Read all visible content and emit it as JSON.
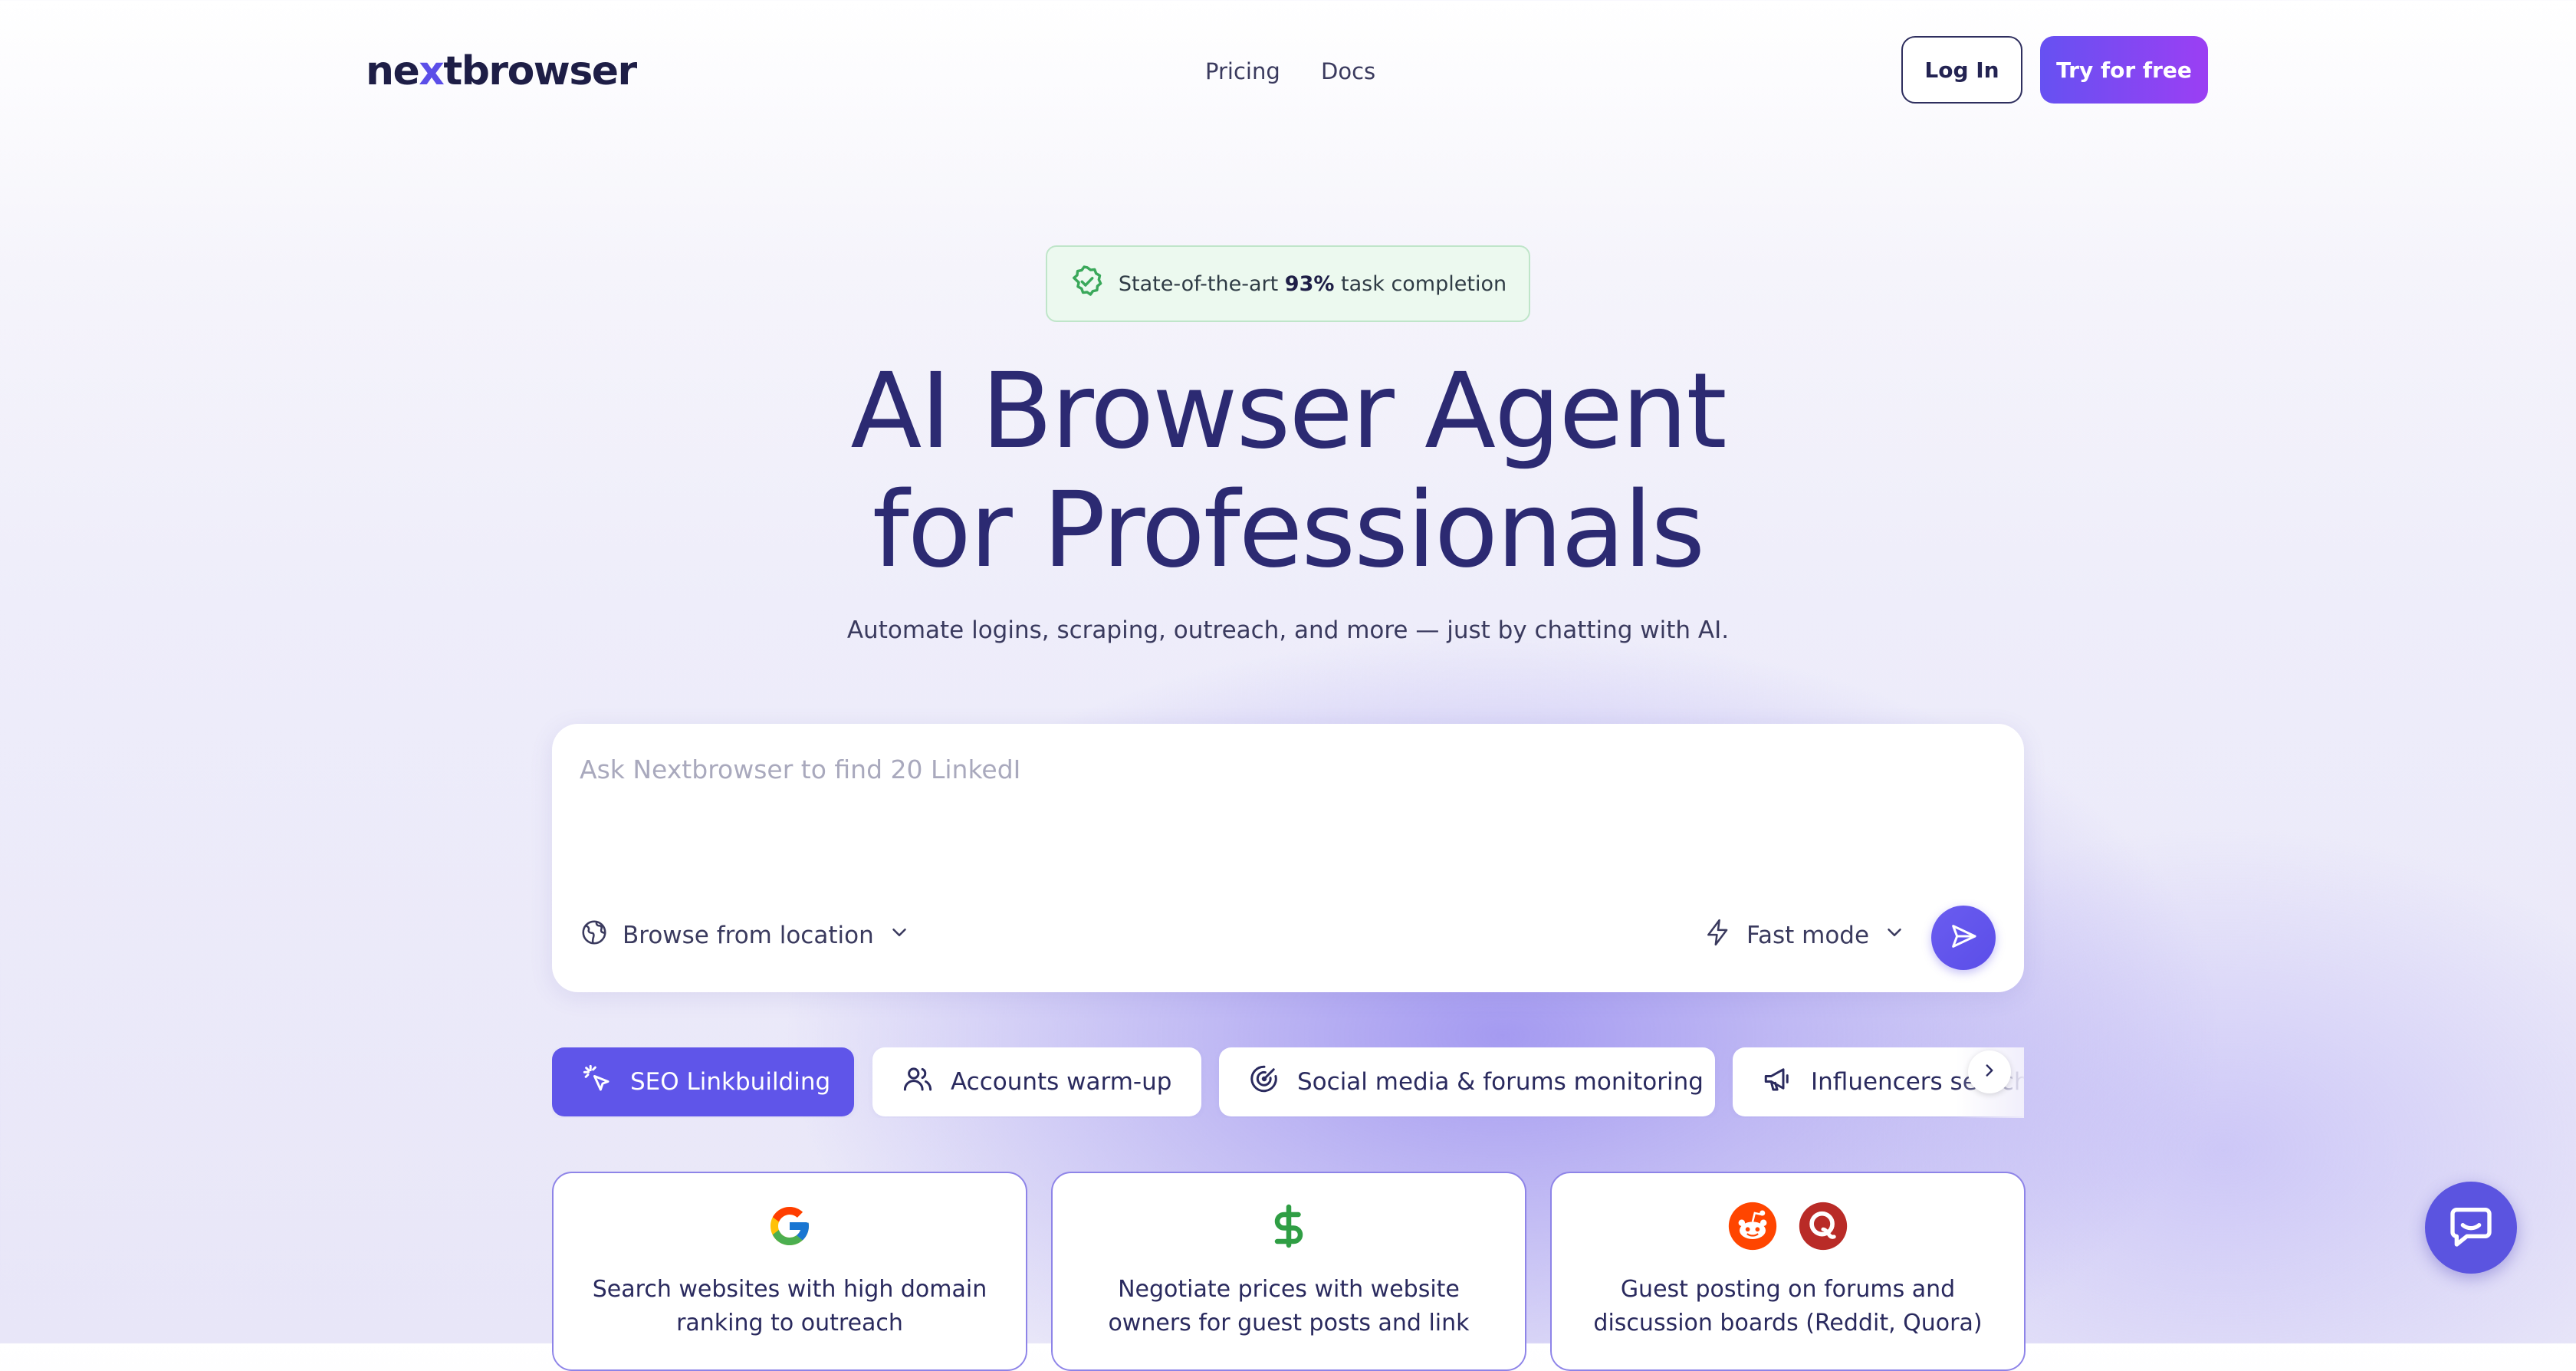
{
  "header": {
    "logo": {
      "prefix": "ne",
      "accent": "x",
      "suffix": "tbrowser"
    },
    "nav": [
      {
        "label": "Pricing"
      },
      {
        "label": "Docs"
      }
    ],
    "login_label": "Log In",
    "try_label": "Try for free"
  },
  "badge": {
    "prefix": "State-of-the-art",
    "highlight": "93%",
    "suffix": "task completion"
  },
  "hero": {
    "line1": "AI Browser Agent",
    "line2": "for Professionals"
  },
  "subtitle": "Automate logins, scraping, outreach, and more — just by chatting with AI.",
  "chat": {
    "placeholder": "Ask Nextbrowser to find 20 LinkedI",
    "location_label": "Browse from location",
    "mode_label": "Fast mode"
  },
  "tabs": [
    {
      "label": "SEO Linkbuilding",
      "icon": "sparkle-cursor-icon",
      "active": true
    },
    {
      "label": "Accounts warm-up",
      "icon": "users-icon",
      "active": false
    },
    {
      "label": "Social media & forums monitoring",
      "icon": "radar-icon",
      "active": false
    },
    {
      "label": "Influencers search",
      "icon": "megaphone-icon",
      "active": false
    }
  ],
  "cards": [
    {
      "text": "Search websites with high domain ranking to outreach",
      "icons": [
        "google-icon"
      ]
    },
    {
      "text": "Negotiate prices with website owners for guest posts and link",
      "icons": [
        "dollar-icon"
      ]
    },
    {
      "text": "Guest posting on forums and discussion boards (Reddit, Quora)",
      "icons": [
        "reddit-icon",
        "quora-icon"
      ]
    }
  ],
  "colors": {
    "brand": "#5b4ee8",
    "hero": "#2c2a72",
    "badge_bg": "#ecf9ef",
    "badge_check": "#3aa85a"
  }
}
